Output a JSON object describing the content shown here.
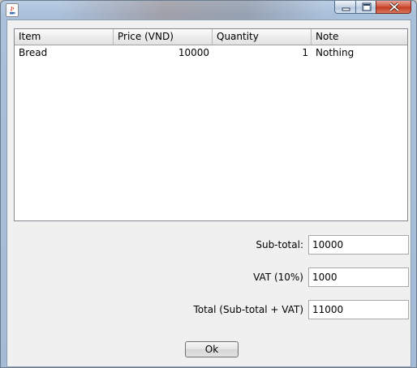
{
  "window": {
    "title": ""
  },
  "table": {
    "columns": [
      "Item",
      "Price (VND)",
      "Quantity",
      "Note"
    ],
    "rows": [
      {
        "item": "Bread",
        "price": "10000",
        "quantity": "1",
        "note": "Nothing"
      }
    ]
  },
  "summary": {
    "subtotal_label": "Sub-total:",
    "subtotal_value": "10000",
    "vat_label": "VAT (10%)",
    "vat_value": "1000",
    "total_label": "Total (Sub-total + VAT)",
    "total_value": "11000"
  },
  "buttons": {
    "ok_label": "Ok"
  },
  "icons": {
    "app": "java-coffee-cup-icon",
    "minimize": "minimize-icon",
    "maximize": "maximize-icon",
    "close": "close-icon"
  },
  "colors": {
    "frame": "#a9c0da",
    "close_button": "#c2391f",
    "content_bg": "#f0f0f0"
  }
}
